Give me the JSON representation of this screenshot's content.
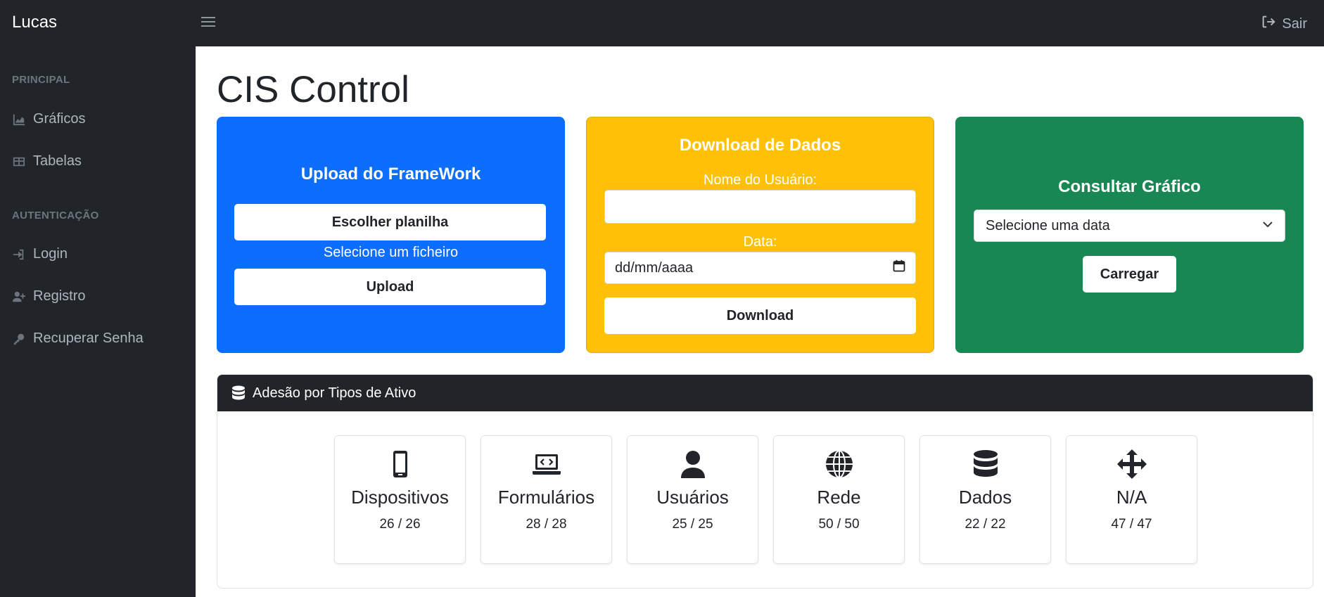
{
  "app": {
    "brand": "Lucas",
    "logout_label": "Sair"
  },
  "sidebar": {
    "sections": [
      {
        "heading": "PRINCIPAL",
        "items": [
          {
            "label": "Gráficos",
            "icon": "chart-area-icon"
          },
          {
            "label": "Tabelas",
            "icon": "table-icon"
          }
        ]
      },
      {
        "heading": "AUTENTICAÇÃO",
        "items": [
          {
            "label": "Login",
            "icon": "sign-in-icon"
          },
          {
            "label": "Registro",
            "icon": "user-plus-icon"
          },
          {
            "label": "Recuperar Senha",
            "icon": "key-icon"
          }
        ]
      }
    ]
  },
  "page": {
    "title": "CIS Control"
  },
  "upload_card": {
    "title": "Upload do FrameWork",
    "choose_button": "Escolher planilha",
    "file_status": "Selecione um ficheiro",
    "upload_button": "Upload",
    "color": "#0d6efd"
  },
  "download_card": {
    "title": "Download de Dados",
    "user_label": "Nome do Usuário:",
    "user_value": "",
    "date_label": "Data:",
    "date_placeholder": "dd/mm/aaaa",
    "download_button": "Download",
    "color": "#ffc107"
  },
  "chart_card": {
    "title": "Consultar Gráfico",
    "select_value": "Selecione uma data",
    "load_button": "Carregar",
    "color": "#198754"
  },
  "adoption": {
    "title": "Adesão por Tipos de Ativo",
    "tiles": [
      {
        "name": "Dispositivos",
        "value": "26 / 26",
        "icon": "tablet-icon"
      },
      {
        "name": "Formulários",
        "value": "28 / 28",
        "icon": "laptop-code-icon"
      },
      {
        "name": "Usuários",
        "value": "25 / 25",
        "icon": "user-icon"
      },
      {
        "name": "Rede",
        "value": "50 / 50",
        "icon": "globe-icon"
      },
      {
        "name": "Dados",
        "value": "22 / 22",
        "icon": "database-icon"
      },
      {
        "name": "N/A",
        "value": "47 / 47",
        "icon": "arrows-icon"
      }
    ]
  }
}
